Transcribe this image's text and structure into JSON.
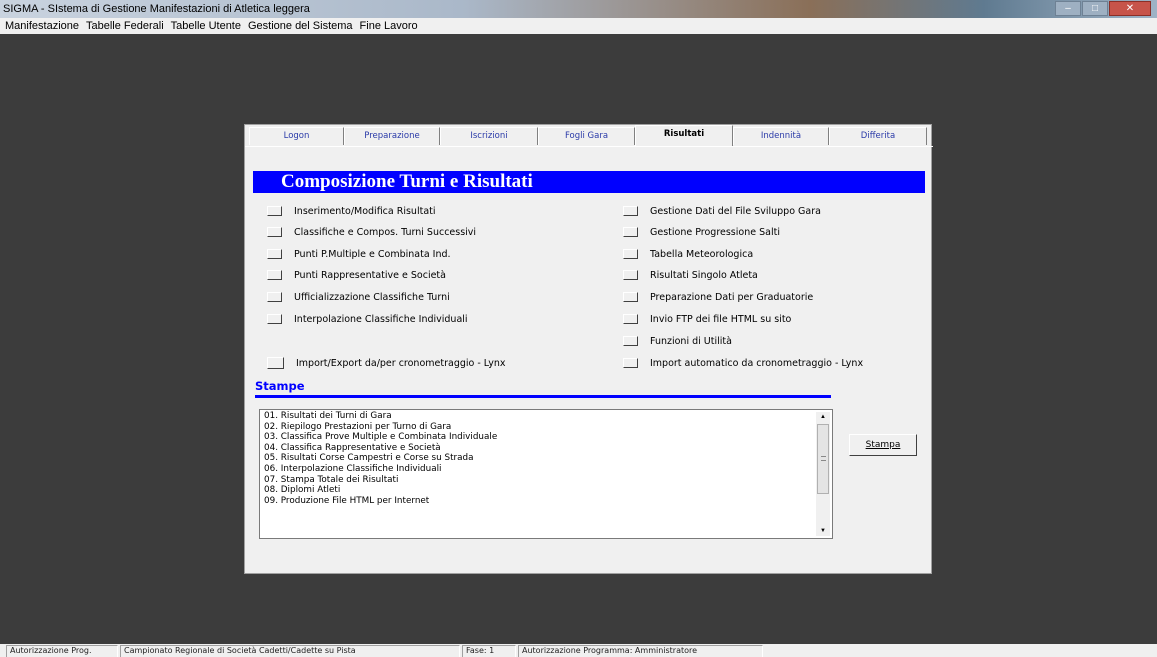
{
  "window": {
    "title": "SIGMA - SIstema di Gestione Manifestazioni di Atletica leggera"
  },
  "menubar": {
    "items": [
      "Manifestazione",
      "Tabelle Federali",
      "Tabelle Utente",
      "Gestione del Sistema",
      "Fine Lavoro"
    ]
  },
  "tabs": [
    {
      "label": "Logon"
    },
    {
      "label": "Preparazione"
    },
    {
      "label": "Iscrizioni"
    },
    {
      "label": "Fogli Gara"
    },
    {
      "label": "Risultati",
      "active": true
    },
    {
      "label": "Indennità"
    },
    {
      "label": "Differita"
    }
  ],
  "header": {
    "title": "Composizione Turni e Risultati"
  },
  "options_left": [
    "Inserimento/Modifica Risultati",
    "Classifiche e Compos. Turni Successivi",
    "Punti  P.Multiple e Combinata Ind.",
    "Punti  Rappresentative e Società",
    "Ufficializzazione Classifiche Turni",
    "Interpolazione Classifiche Individuali"
  ],
  "options_right": [
    "Gestione Dati del File Sviluppo Gara",
    "Gestione Progressione Salti",
    "Tabella Meteorologica",
    "Risultati Singolo Atleta",
    "Preparazione Dati per Graduatorie",
    "Invio FTP dei file HTML su sito",
    "Funzioni di Utilità"
  ],
  "option_import_export": "Import/Export da/per cronometraggio - Lynx",
  "option_import_auto": "Import automatico da cronometraggio - Lynx",
  "stampe": {
    "title": "Stampe",
    "items": [
      "01.  Risultati dei Turni di Gara",
      "02.  Riepilogo Prestazioni per Turno di Gara",
      "03.  Classifica Prove Multiple e Combinata Individuale",
      "04.  Classifica Rappresentative e Società",
      "05.  Risultati Corse Campestri e Corse su Strada",
      "06.  Interpolazione Classifiche Individuali",
      "07.  Stampa Totale dei Risultati",
      "08.  Diplomi Atleti",
      "09.  Produzione File HTML per Internet"
    ],
    "button_label": "Stampa"
  },
  "statusbar": {
    "auth": "Autorizzazione Prog.",
    "event": "Campionato Regionale di Società Cadetti/Cadette su Pista",
    "phase": "Fase: 1",
    "program_auth": "Autorizzazione Programma: Amministratore"
  },
  "colors": {
    "header_bg": "#0000ff",
    "desktop_bg": "#3c3c3c",
    "panel_bg": "#f0f0f0"
  }
}
